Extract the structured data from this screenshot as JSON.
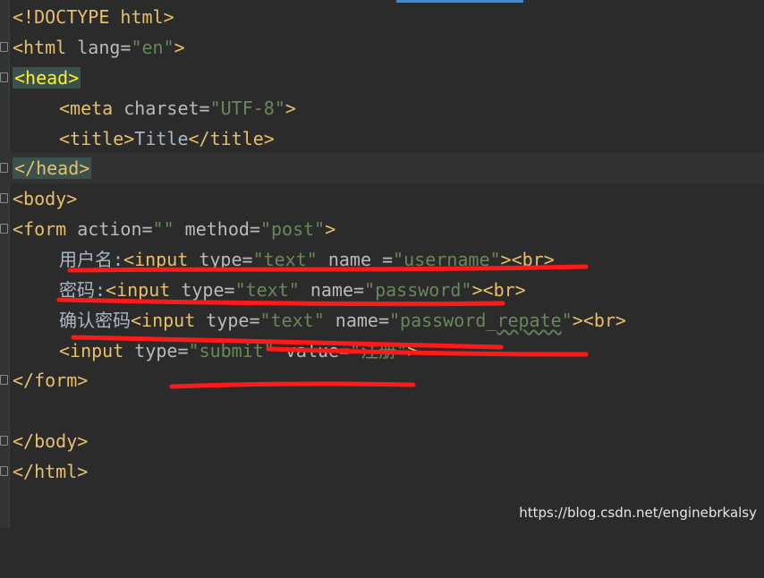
{
  "editor": {
    "lines": {
      "doctype": "<!DOCTYPE html>",
      "html_open_a": "<html ",
      "html_lang_attr": "lang=",
      "html_lang_val": "\"en\"",
      "html_open_b": ">",
      "head_open": "<head>",
      "meta_open": "<meta ",
      "meta_attr": "charset=",
      "meta_val": "\"UTF-8\"",
      "meta_close": ">",
      "title_open": "<title>",
      "title_text": "Title",
      "title_close": "</title>",
      "head_close": "</head>",
      "body_open": "<body>",
      "form_open_a": "<form ",
      "form_action_attr": "action=",
      "form_action_val": "\"\"",
      "form_method_attr": " method=",
      "form_method_val": "\"post\"",
      "form_open_b": ">",
      "l1_label": "用户名:",
      "l1_tag": "<input ",
      "l1_type_attr": "type=",
      "l1_type_val": "\"text\"",
      "l1_name_attr": " name =",
      "l1_name_val": "\"username\"",
      "l1_end": "><br>",
      "l2_label": "密码:",
      "l2_tag": "<input ",
      "l2_type_attr": "type=",
      "l2_type_val": "\"text\"",
      "l2_name_attr": " name=",
      "l2_name_val": "\"password\"",
      "l2_end": "><br>",
      "l3_label": "确认密码",
      "l3_tag": "<input ",
      "l3_type_attr": "type=",
      "l3_type_val": "\"text\"",
      "l3_name_attr": " name=",
      "l3_name_val_a": "\"password_",
      "l3_name_val_b": "repate",
      "l3_name_val_c": "\"",
      "l3_end": "><br>",
      "l4_tag": "<input ",
      "l4_type_attr": "type=",
      "l4_type_val": "\"submit\"",
      "l4_value_attr": " value=",
      "l4_value_val": "\"注册\"",
      "l4_end": ">",
      "form_close": "</form>",
      "body_close": "</body>",
      "html_close": "</html>"
    }
  },
  "colors": {
    "background": "#2b2b2b",
    "tag": "#e8bf6a",
    "attribute": "#bababa",
    "string": "#6a8759",
    "annotation": "#ff2020"
  },
  "watermark": "https://blog.csdn.net/enginebrkalsy"
}
